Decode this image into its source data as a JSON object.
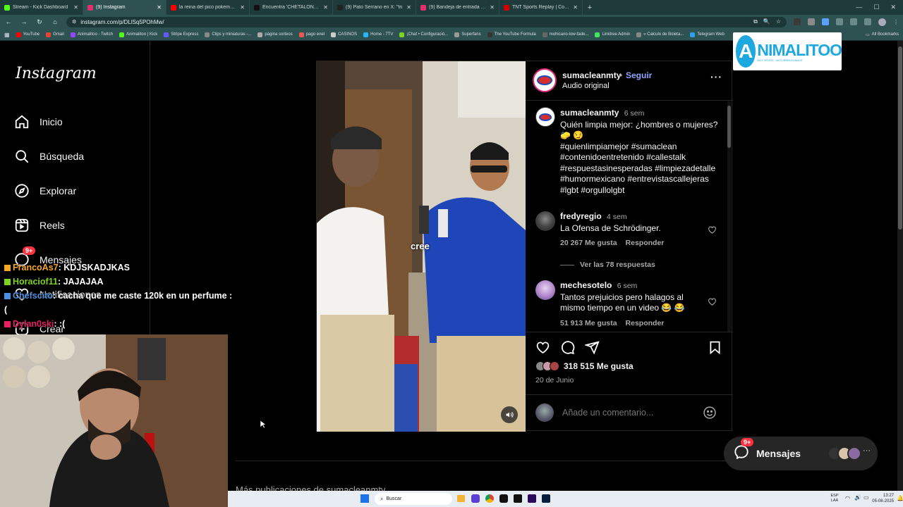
{
  "browser": {
    "tabs": [
      {
        "title": "Stream - Kick Dashboard",
        "color": "#53fc18"
      },
      {
        "title": "(9) Instagram",
        "color": "#e1306c",
        "active": true
      },
      {
        "title": "la reina del pico pokemon - Yo",
        "color": "#ff0000"
      },
      {
        "title": "Encuentra 'CHETALONSO' -",
        "color": "#111111"
      },
      {
        "title": "(9) Pato Serrano en X: \"tn",
        "color": "#222222"
      },
      {
        "title": "(9) Bandeja de entrada • Chats",
        "color": "#e1306c"
      },
      {
        "title": "TNT Sports Replay | Colo Colo",
        "color": "#d40000"
      }
    ],
    "url": "instagram.com/p/DLlSq5POhMw/",
    "bookmarks": [
      "YouTube",
      "Gmail",
      "Animalitoo - Twitch",
      "Animalitoo | Kick",
      "Stripe Express",
      "Clips y miniaturas -...",
      "página sorteos",
      "pago enel",
      "CASINOS",
      "Home - 7TV",
      "¡Chat • Configuració...",
      "Superfans",
      "The YouTube Formula",
      "mohicano-low-fade...",
      "Linktree Admin",
      "« Calculo de Boleta...",
      "Telegram Web"
    ],
    "all_bookmarks": "All Bookmarks"
  },
  "sidebar": {
    "logo": "Instagram",
    "items": [
      {
        "label": "Inicio",
        "icon": "home-icon"
      },
      {
        "label": "Búsqueda",
        "icon": "search-icon"
      },
      {
        "label": "Explorar",
        "icon": "compass-icon"
      },
      {
        "label": "Reels",
        "icon": "reels-icon"
      },
      {
        "label": "Mensajes",
        "icon": "messenger-icon",
        "badge": "9+"
      },
      {
        "label": "Notificaciones",
        "icon": "heart-icon"
      },
      {
        "label": "Crear",
        "icon": "plus-icon"
      }
    ]
  },
  "post": {
    "username": "sumacleanmty",
    "follow": "Seguir",
    "audio": "Audio original",
    "caption_user": "sumacleanmty",
    "caption_time": "6 sem",
    "caption_text": "Quién limpia mejor: ¿hombres o mujeres? 🧽 😏",
    "hashtags": "#quienlimpiamejor #sumaclean #contenidoentretenido #callestalk #respuestasinesperadas #limpiezadetalle #humormexicano #entrevistascallejeras #lgbt #orgullolgbt",
    "subtitle": "cree",
    "comments": [
      {
        "user": "fredyregio",
        "time": "4 sem",
        "text": "La Ofensa de Schrödinger.",
        "likes": "20 267 Me gusta",
        "reply": "Responder",
        "view_replies": "Ver las 78 respuestas"
      },
      {
        "user": "mechesotelo",
        "time": "6 sem",
        "text": "Tantos prejuicios pero halagos al mismo tiempo en un video 😂 😂",
        "likes": "51 913 Me gusta",
        "reply": "Responder"
      }
    ],
    "likes_total": "318 515 Me gusta",
    "date": "20 de Junio",
    "comment_placeholder": "Añade un comentario..."
  },
  "chat": [
    {
      "user": "FrancoAs7",
      "msg": "KDJSKADJKAS",
      "color": "#f5a623"
    },
    {
      "user": "Horaciof11",
      "msg": "JAJAJAA",
      "color": "#7ed321"
    },
    {
      "user": "Chefscito",
      "msg": "cacha que me caste 120k en un perfume :(",
      "color": "#4a90e2"
    },
    {
      "user": "Dylan0ski",
      "msg": ":(",
      "color": "#e91e63"
    }
  ],
  "overlay": {
    "brand": "NIMALITOO",
    "brand_prefix": "A",
    "tagline": "NOT SPORT - NOT IRRELEVANCE"
  },
  "mensajes_pill": {
    "label": "Mensajes",
    "badge": "9+"
  },
  "taskbar": {
    "search": "Buscar",
    "lang": "ESP LAA",
    "time": "13:27",
    "date": "05-08-2025"
  },
  "more_from": "Más publicaciones de sumacleanmty"
}
